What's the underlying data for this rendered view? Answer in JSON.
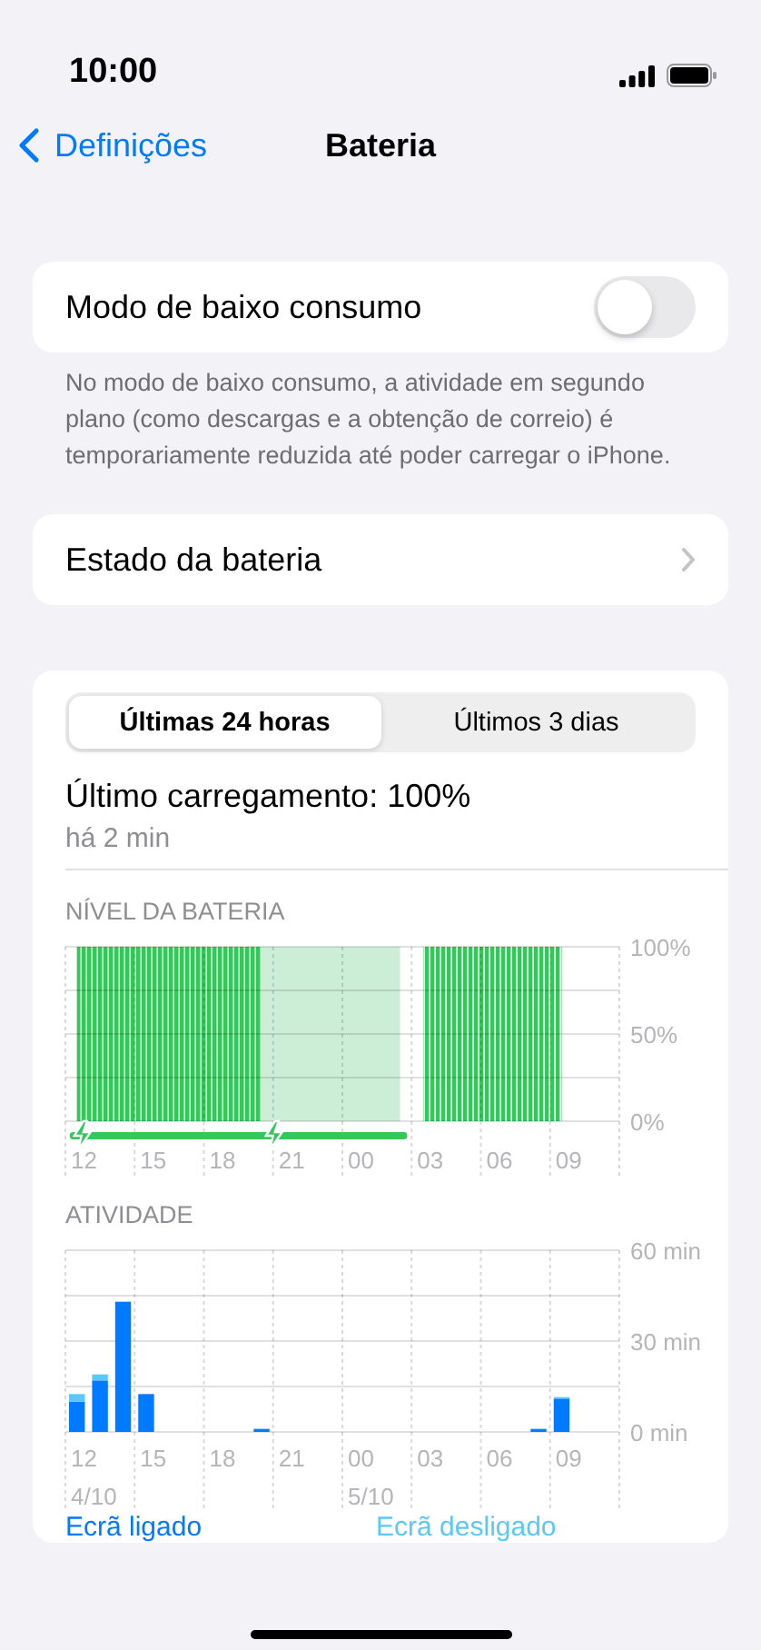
{
  "status_bar": {
    "time": "10:00"
  },
  "nav": {
    "back": "Definições",
    "title": "Bateria"
  },
  "low_power": {
    "label": "Modo de baixo consumo",
    "on": false,
    "footer": "No modo de baixo consumo, a atividade em segundo plano (como descargas e a obtenção de correio) é temporariamente reduzida até poder carregar o iPhone."
  },
  "health": {
    "label": "Estado da bateria"
  },
  "usage": {
    "tabs": [
      {
        "label": "Últimas 24 horas",
        "selected": true
      },
      {
        "label": "Últimos 3 dias",
        "selected": false
      }
    ],
    "last_charge": "Último carregamento: 100%",
    "last_charge_time": "há 2 min",
    "battery_level": {
      "title": "NÍVEL DA BATERIA",
      "chart_data": {
        "type": "area",
        "grid": true,
        "categories": [
          "12",
          null,
          null,
          "15",
          null,
          null,
          "18",
          null,
          null,
          "21",
          null,
          null,
          "00",
          null,
          null,
          "03",
          null,
          null,
          "06",
          null,
          null,
          "09",
          null,
          null
        ],
        "series": [
          {
            "color": "#cdeed6",
            "values": [
              100,
              100,
              100,
              100,
              100,
              100,
              100,
              100,
              100,
              100,
              100,
              100,
              100,
              100,
              100,
              null,
              null,
              null,
              null,
              null,
              null,
              null,
              null,
              null
            ]
          },
          {
            "color": "#34c759",
            "values": [
              100,
              100,
              100,
              100,
              100,
              100,
              100,
              100,
              100,
              null,
              null,
              null,
              null,
              null,
              null,
              100,
              100,
              100,
              100,
              100,
              100,
              100,
              null,
              null
            ]
          }
        ],
        "ylim": [
          0,
          100
        ],
        "yticks": [
          {
            "value": 0,
            "label": "0%"
          },
          {
            "value": 50,
            "label": "50%"
          },
          {
            "value": 100,
            "label": "100%"
          }
        ]
      }
    },
    "activity": {
      "title": "ATIVIDADE",
      "dates": [
        "4/10",
        "5/10"
      ],
      "chart_data": {
        "type": "bar",
        "stacked": true,
        "grid": true,
        "categories": [
          "12",
          null,
          null,
          "15",
          null,
          null,
          "18",
          null,
          null,
          "21",
          null,
          null,
          "00",
          null,
          null,
          "03",
          null,
          null,
          "06",
          null,
          null,
          "09",
          null,
          null
        ],
        "series": [
          {
            "name": "Ecrã ligado",
            "color": "#007aff",
            "values": [
              10,
              17,
              43,
              12.5,
              0,
              0,
              0,
              0,
              1,
              0,
              0,
              0,
              0,
              0,
              0,
              0,
              0,
              0,
              0,
              0,
              1,
              11,
              0,
              0
            ]
          },
          {
            "name": "Ecrã desligado",
            "color": "#5ac8fa",
            "values": [
              2.5,
              2,
              0,
              0,
              0,
              0,
              0,
              0,
              0,
              0,
              0,
              0,
              0,
              0,
              0,
              0,
              0,
              0,
              0,
              0,
              0,
              0.5,
              0,
              0
            ]
          }
        ],
        "ylim": [
          0,
          60
        ],
        "yticks": [
          {
            "value": 0,
            "label": "0 min"
          },
          {
            "value": 30,
            "label": "30 min"
          },
          {
            "value": 60,
            "label": "60 min"
          }
        ]
      }
    }
  }
}
